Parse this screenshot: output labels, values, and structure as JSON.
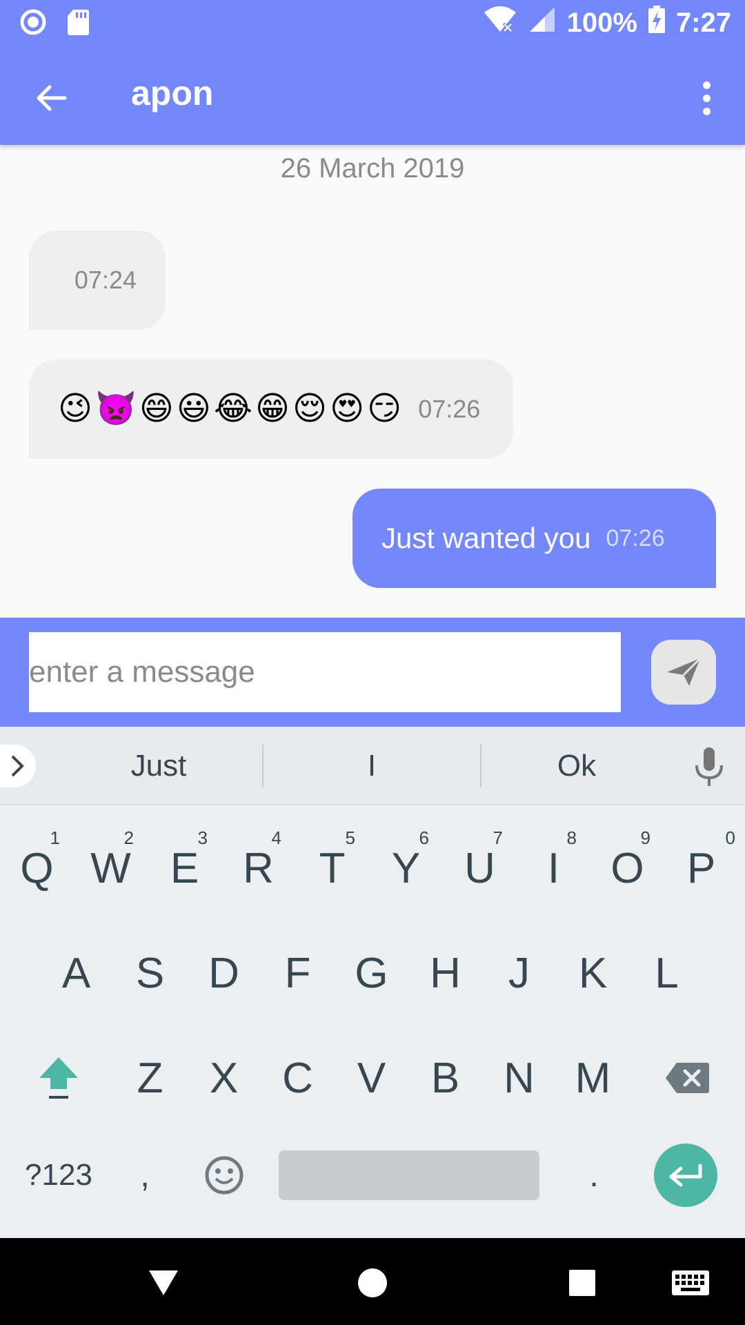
{
  "status_bar": {
    "battery_text": "100%",
    "time": "7:27",
    "icons": [
      "sync-icon",
      "sd-card-icon",
      "wifi-off-icon",
      "signal-icon",
      "battery-charging-icon"
    ]
  },
  "app_bar": {
    "title": "apon",
    "back_icon": "arrow-back-icon",
    "menu_icon": "more-vert-icon"
  },
  "chat": {
    "date": "26 March 2019",
    "messages": [
      {
        "direction": "incoming",
        "text": "",
        "time": "07:24"
      },
      {
        "direction": "incoming",
        "emojis": [
          "😉",
          "👿",
          "😄",
          "😃",
          "😂",
          "😁",
          "😌",
          "😍",
          "😏"
        ],
        "time": "07:26"
      },
      {
        "direction": "outgoing",
        "text": "Just wanted you",
        "time": "07:26"
      }
    ]
  },
  "input": {
    "placeholder": "enter a message",
    "value": "",
    "send_icon": "send-icon"
  },
  "keyboard": {
    "suggestions": [
      "Just",
      "I",
      "Ok"
    ],
    "row1": [
      {
        "k": "Q",
        "h": "1"
      },
      {
        "k": "W",
        "h": "2"
      },
      {
        "k": "E",
        "h": "3"
      },
      {
        "k": "R",
        "h": "4"
      },
      {
        "k": "T",
        "h": "5"
      },
      {
        "k": "Y",
        "h": "6"
      },
      {
        "k": "U",
        "h": "7"
      },
      {
        "k": "I",
        "h": "8"
      },
      {
        "k": "O",
        "h": "9"
      },
      {
        "k": "P",
        "h": "0"
      }
    ],
    "row2": [
      "A",
      "S",
      "D",
      "F",
      "G",
      "H",
      "J",
      "K",
      "L"
    ],
    "row3": [
      "Z",
      "X",
      "C",
      "V",
      "B",
      "N",
      "M"
    ],
    "bottom": {
      "symbols": "?123",
      "comma": ",",
      "period": "."
    }
  },
  "colors": {
    "accent": "#7487fc",
    "enter_key": "#4db6a5",
    "incoming_bubble": "#efefef"
  }
}
